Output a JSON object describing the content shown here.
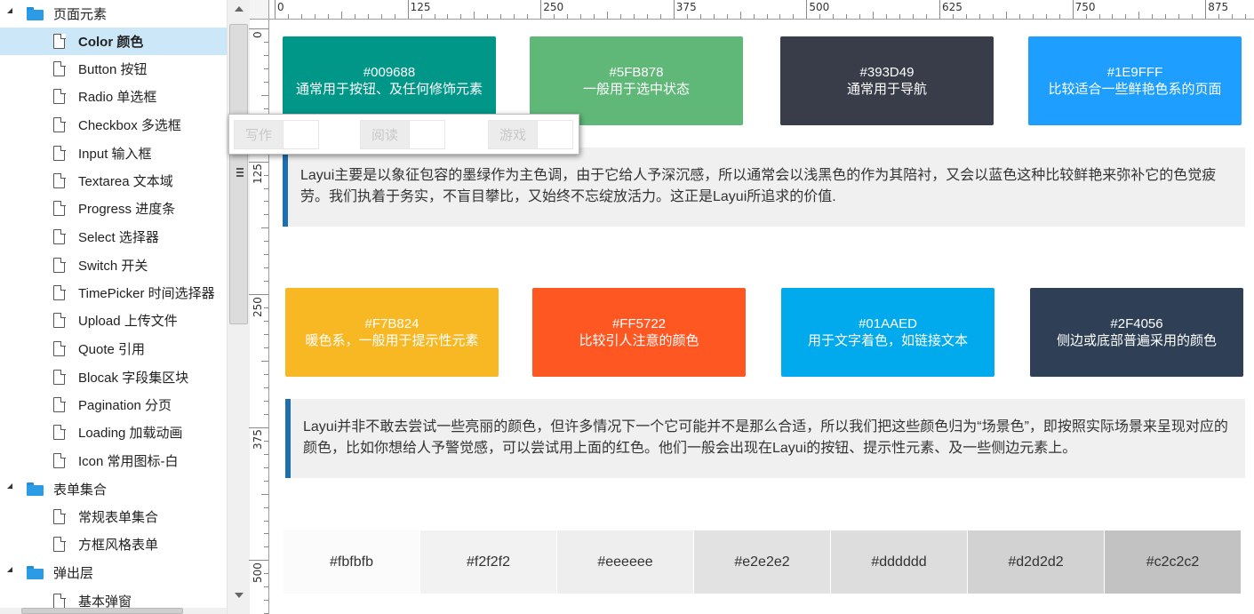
{
  "sidebar": {
    "groups": [
      {
        "label": "页面元素",
        "items": [
          {
            "label": "Color 颜色",
            "selected": true
          },
          {
            "label": "Button 按钮"
          },
          {
            "label": "Radio 单选框"
          },
          {
            "label": "Checkbox 多选框"
          },
          {
            "label": "Input 输入框"
          },
          {
            "label": "Textarea 文本域"
          },
          {
            "label": "Progress 进度条"
          },
          {
            "label": "Select 选择器"
          },
          {
            "label": "Switch 开关"
          },
          {
            "label": "TimePicker 时间选择器"
          },
          {
            "label": "Upload 上传文件"
          },
          {
            "label": "Quote 引用"
          },
          {
            "label": "Blocak 字段集区块"
          },
          {
            "label": "Pagination 分页"
          },
          {
            "label": "Loading 加载动画"
          },
          {
            "label": "Icon 常用图标-白"
          }
        ]
      },
      {
        "label": "表单集合",
        "items": [
          {
            "label": "常规表单集合"
          },
          {
            "label": "方框风格表单"
          }
        ]
      },
      {
        "label": "弹出层",
        "items": [
          {
            "label": "基本弹窗"
          }
        ]
      }
    ]
  },
  "ruler": {
    "top_labels": [
      "0",
      "125",
      "250",
      "375",
      "500",
      "625",
      "750",
      "875"
    ],
    "left_labels": [
      "0",
      "125",
      "250",
      "375",
      "500"
    ]
  },
  "floating_tabs": [
    {
      "label": "写作"
    },
    {
      "label": "阅读"
    },
    {
      "label": "游戏"
    }
  ],
  "swatch_row_1": [
    {
      "hex": "#009688",
      "desc": "通常用于按钮、及任何修饰元素",
      "color": "#009688"
    },
    {
      "hex": "#5FB878",
      "desc": "一般用于选中状态",
      "color": "#5FB878"
    },
    {
      "hex": "#393D49",
      "desc": "通常用于导航",
      "color": "#393D49"
    },
    {
      "hex": "#1E9FFF",
      "desc": "比较适合一些鲜艳色系的页面",
      "color": "#1E9FFF"
    }
  ],
  "quote_1": "Layui主要是以象征包容的墨绿作为主色调，由于它给人予深沉感，所以通常会以浅黑色的作为其陪衬，又会以蓝色这种比较鲜艳来弥补它的色觉疲劳。我们执着于务实，不盲目攀比，又始终不忘绽放活力。这正是Layui所追求的价值.",
  "swatch_row_2": [
    {
      "hex": "#F7B824",
      "desc": "暖色系，一般用于提示性元素",
      "color": "#F7B824"
    },
    {
      "hex": "#FF5722",
      "desc": "比较引人注意的颜色",
      "color": "#FF5722"
    },
    {
      "hex": "#01AAED",
      "desc": "用于文字着色，如链接文本",
      "color": "#01AAED"
    },
    {
      "hex": "#2F4056",
      "desc": "侧边或底部普遍采用的颜色",
      "color": "#2F4056"
    }
  ],
  "quote_2": "Layui并非不敢去尝试一些亮丽的颜色，但许多情况下一个它可能并不是那么合适，所以我们把这些颜色归为“场景色”，即按照实际场景来呈现对应的颜色，比如你想给人予警觉感，可以尝试用上面的红色。他们一般会出现在Layui的按钮、提示性元素、及一些侧边元素上。",
  "grays": [
    {
      "hex": "#fbfbfb",
      "color": "#fbfbfb"
    },
    {
      "hex": "#f2f2f2",
      "color": "#f2f2f2"
    },
    {
      "hex": "#eeeeee",
      "color": "#eeeeee"
    },
    {
      "hex": "#e2e2e2",
      "color": "#e2e2e2"
    },
    {
      "hex": "#dddddd",
      "color": "#dddddd"
    },
    {
      "hex": "#d2d2d2",
      "color": "#d2d2d2"
    },
    {
      "hex": "#c2c2c2",
      "color": "#c2c2c2"
    }
  ]
}
